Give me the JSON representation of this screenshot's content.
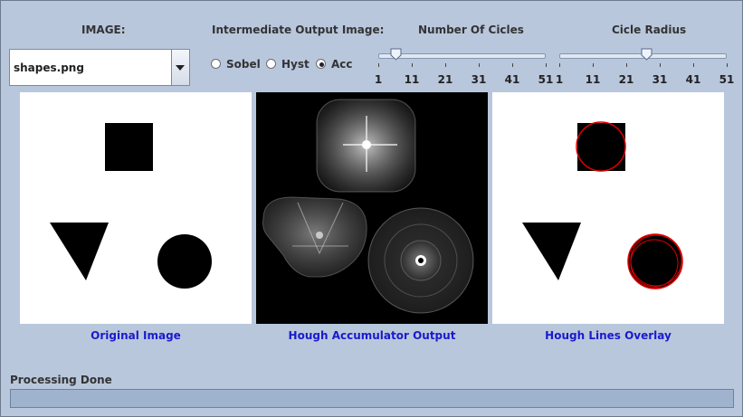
{
  "labels": {
    "image": "IMAGE:",
    "intermediate": "Intermediate Output Image:",
    "num_circles": "Number Of Cicles",
    "circle_radius": "Cicle Radius"
  },
  "image_select": {
    "value": "shapes.png",
    "icon": "chevron-down-icon"
  },
  "intermediate_radio": {
    "options": [
      "Sobel",
      "Hyst",
      "Acc"
    ],
    "selected": "Acc"
  },
  "sliders": {
    "num_circles": {
      "min": 1,
      "max": 51,
      "value": 6,
      "ticks": [
        "1",
        "11",
        "21",
        "31",
        "41",
        "51"
      ]
    },
    "circle_radius": {
      "min": 1,
      "max": 51,
      "value": 27,
      "ticks": [
        "1",
        "11",
        "21",
        "31",
        "41",
        "51"
      ]
    }
  },
  "panels": {
    "original": {
      "caption": "Original Image"
    },
    "accumulator": {
      "caption": "Hough Accumulator Output"
    },
    "overlay": {
      "caption": "Hough Lines Overlay"
    }
  },
  "status": {
    "text": "Processing Done",
    "progress": 0
  },
  "colors": {
    "background": "#b9c7dd",
    "caption": "#1a1acc",
    "overlay_circle": "#dd0000"
  }
}
